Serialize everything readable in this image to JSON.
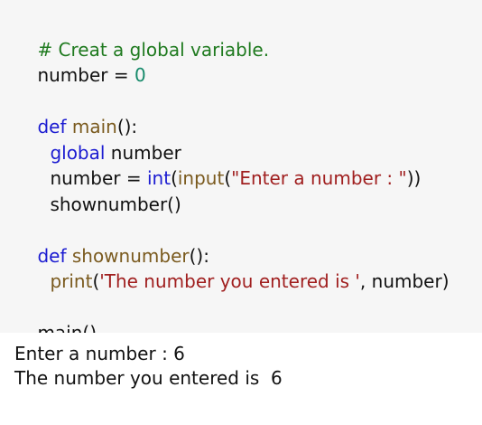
{
  "code": {
    "line1": {
      "comment": "# Creat a global variable."
    },
    "line2": {
      "var": "number",
      "op": " = ",
      "num": "0"
    },
    "line4": {
      "kw": "def",
      "fn": "main",
      "rest": "():"
    },
    "line5": {
      "kw": "global",
      "rest": " number"
    },
    "line6": {
      "var": "number",
      "op": " = ",
      "fn_int": "int",
      "p1": "(",
      "fn_input": "input",
      "p2": "(",
      "str": "\"Enter a number : \"",
      "p3": "))"
    },
    "line7": {
      "call": "shownumber()"
    },
    "line9": {
      "kw": "def",
      "fn": "shownumber",
      "rest": "():"
    },
    "line10": {
      "fn": "print",
      "p1": "(",
      "str": "'The number you entered is '",
      "rest": ", number)"
    },
    "line12": {
      "call": "main()"
    }
  },
  "output": {
    "line1": "Enter a number : 6",
    "line2": "The number you entered is  6"
  },
  "colors": {
    "comment": "#1f7a1f",
    "keyword": "#1b1bd1",
    "function": "#7a5a1e",
    "string": "#a01f1f",
    "number": "#168a6a",
    "code_background": "#f6f6f6"
  }
}
